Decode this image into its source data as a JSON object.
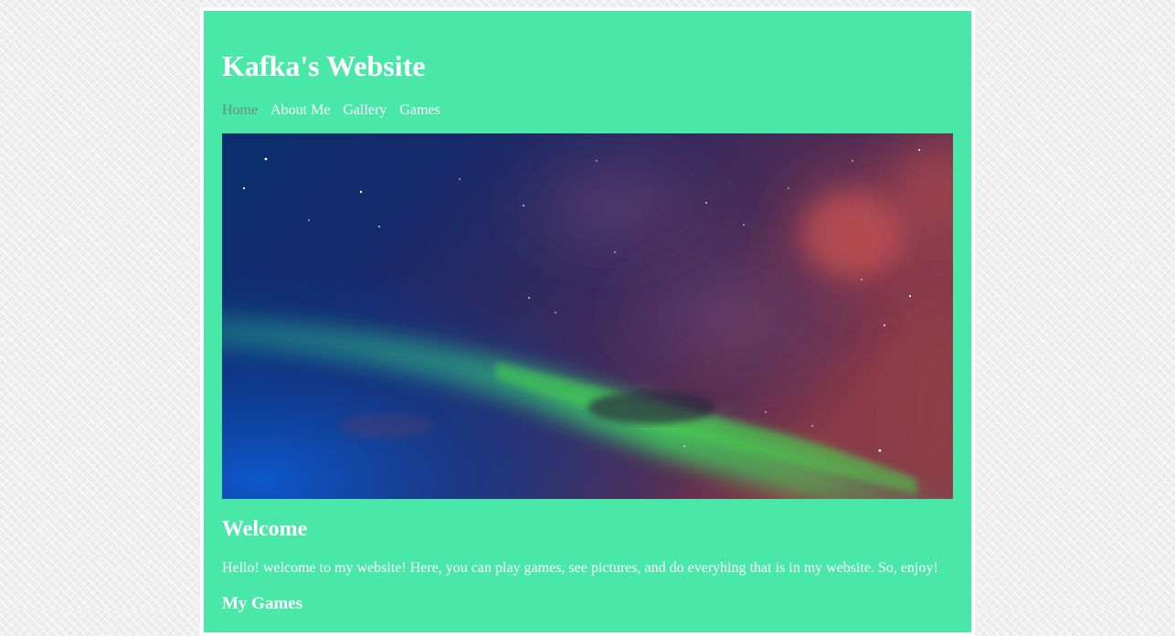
{
  "site": {
    "title": "Kafka's Website"
  },
  "nav": {
    "items": [
      {
        "label": "Home",
        "active": true
      },
      {
        "label": "About Me",
        "active": false
      },
      {
        "label": "Gallery",
        "active": false
      },
      {
        "label": "Games",
        "active": false
      }
    ]
  },
  "hero": {
    "subject": "aurora night sky with stars and reddish clouds"
  },
  "content": {
    "welcome_heading": "Welcome",
    "intro_text": "Hello! welcome to my website! Here, you can play games, see pictures, and do everyhing that is in my website. So, enjoy!",
    "games_heading": "My Games"
  },
  "colors": {
    "page_background": "#efefef",
    "panel_background": "#49e8a8",
    "panel_border": "#ffffff",
    "text": "#ffffff",
    "nav_active": "#6f8a7c"
  }
}
